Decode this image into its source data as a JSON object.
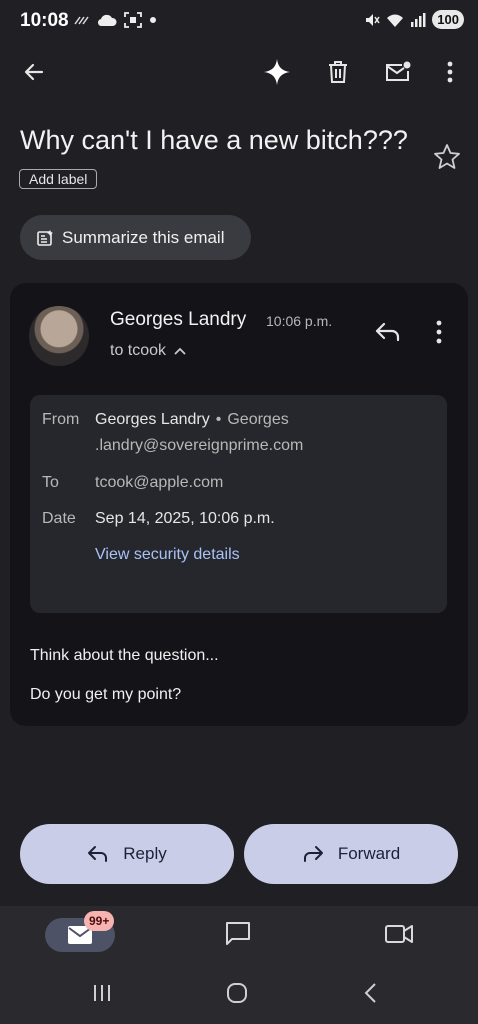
{
  "status_bar": {
    "time": "10:08",
    "battery": "100"
  },
  "email": {
    "subject": "Why can't I have a new bitch???",
    "add_label": "Add label",
    "summarize_label": "Summarize this email",
    "sender_name": "Georges Landry",
    "time": "10:06 p.m.",
    "to_short": "to tcook",
    "details": {
      "from_label": "From",
      "from_name": "Georges Landry",
      "from_separator": "•",
      "from_email_line1": "Georges",
      "from_email_line2": ".landry@sovereignprime.com",
      "to_label": "To",
      "to_value": "tcook@apple.com",
      "date_label": "Date",
      "date_value": "Sep 14, 2025, 10:06 p.m.",
      "security_link": "View security details"
    },
    "body": [
      "Think about the question...",
      "Do you get my point?"
    ]
  },
  "actions": {
    "reply": "Reply",
    "forward": "Forward"
  },
  "bottom_nav": {
    "mail_badge": "99+"
  },
  "icons": [
    "back-arrow-icon",
    "gemini-sparkle-icon",
    "delete-icon",
    "mark-unread-icon",
    "more-vert-icon",
    "star-icon",
    "summarize-icon",
    "reply-icon",
    "forward-icon",
    "mail-icon",
    "chat-icon",
    "meet-video-icon"
  ],
  "colors": {
    "background": "#1f1f24",
    "card": "#141418",
    "button": "#c9cde8",
    "link": "#a9c2f5",
    "badge": "#f7b3b0"
  }
}
